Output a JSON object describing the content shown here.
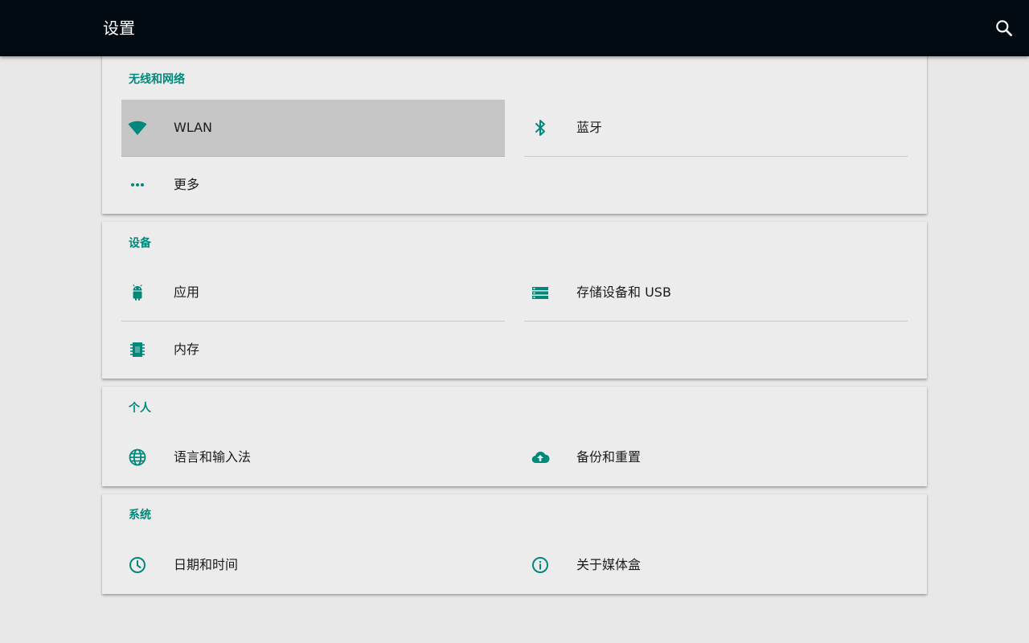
{
  "header": {
    "title": "设置",
    "search_icon": "search-icon"
  },
  "accent_color": "#00897b",
  "sections": [
    {
      "title": "无线和网络",
      "items": [
        {
          "label": "WLAN",
          "icon": "wifi-icon",
          "selected": true
        },
        {
          "label": "蓝牙",
          "icon": "bluetooth-icon"
        },
        {
          "label": "更多",
          "icon": "more-dots-icon"
        }
      ]
    },
    {
      "title": "设备",
      "items": [
        {
          "label": "应用",
          "icon": "android-icon"
        },
        {
          "label": "存储设备和 USB",
          "icon": "storage-icon"
        },
        {
          "label": "内存",
          "icon": "memory-chip-icon"
        }
      ]
    },
    {
      "title": "个人",
      "items": [
        {
          "label": "语言和输入法",
          "icon": "globe-icon"
        },
        {
          "label": "备份和重置",
          "icon": "cloud-upload-icon"
        }
      ]
    },
    {
      "title": "系统",
      "items": [
        {
          "label": "日期和时间",
          "icon": "clock-icon"
        },
        {
          "label": "关于媒体盒",
          "icon": "info-icon"
        }
      ]
    }
  ]
}
